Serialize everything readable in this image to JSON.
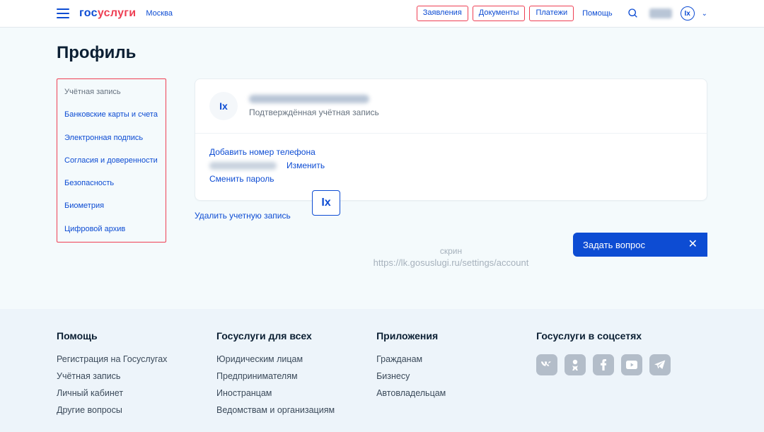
{
  "header": {
    "logo_blue_pre": "гос",
    "logo_red": "услуги",
    "city": "Москва",
    "nav": [
      "Заявления",
      "Документы",
      "Платежи"
    ],
    "help": "Помощь",
    "avatar_initials": "Ix"
  },
  "page": {
    "title": "Профиль",
    "sidebar": [
      {
        "label": "Учётная запись",
        "muted": true
      },
      {
        "label": "Банковские карты и счета",
        "muted": false
      },
      {
        "label": "Электронная подпись",
        "muted": false
      },
      {
        "label": "Согласия и доверенности",
        "muted": false
      },
      {
        "label": "Безопасность",
        "muted": false
      },
      {
        "label": "Биометрия",
        "muted": false
      },
      {
        "label": "Цифровой архив",
        "muted": false
      }
    ],
    "card": {
      "avatar_initials": "Ix",
      "status": "Подтверждённая учётная запись",
      "add_phone": "Добавить номер телефона",
      "change": "Изменить",
      "change_password": "Сменить пароль"
    },
    "delete_account": "Удалить учетную запись",
    "float_badge": "Ix",
    "caption_label": "скрин",
    "caption_url": "https://lk.gosuslugi.ru/settings/account",
    "ask_question": "Задать вопрос"
  },
  "footer": {
    "cols": [
      {
        "head": "Помощь",
        "links": [
          "Регистрация на Госуслугах",
          "Учётная запись",
          "Личный кабинет",
          "Другие вопросы"
        ]
      },
      {
        "head": "Госуслуги для всех",
        "links": [
          "Юридическим лицам",
          "Предпринимателям",
          "Иностранцам",
          "Ведомствам и организациям"
        ]
      },
      {
        "head": "Приложения",
        "links": [
          "Гражданам",
          "Бизнесу",
          "Автовладельцам"
        ]
      }
    ],
    "social_head": "Госуслуги в соцсетях"
  }
}
